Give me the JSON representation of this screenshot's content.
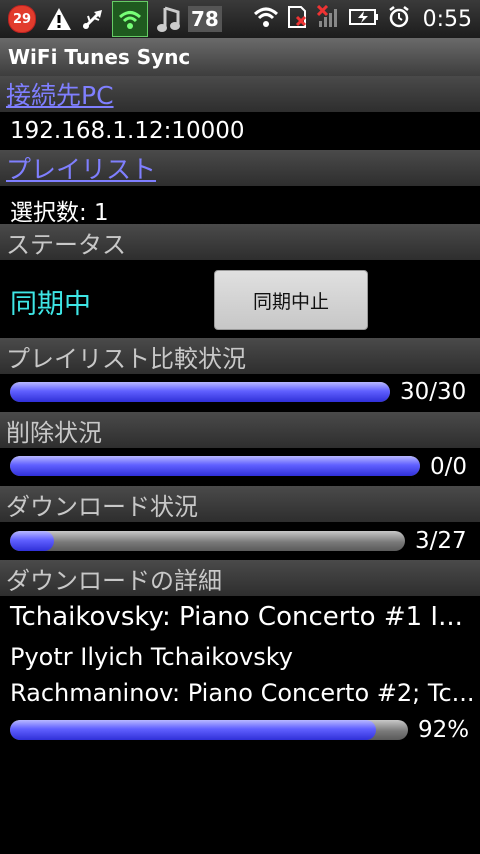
{
  "status_bar": {
    "notification_count": "29",
    "battery_percent": "78",
    "time": "0:55",
    "icons": [
      "warning-icon",
      "usb-icon",
      "shield-icon",
      "music-note-icon",
      "wifi-icon",
      "sim-icon",
      "signal-off-icon",
      "battery-charging-icon",
      "alarm-icon"
    ]
  },
  "app": {
    "title": "WiFi Tunes Sync"
  },
  "connection": {
    "header": "接続先PC",
    "value": "192.168.1.12:10000"
  },
  "playlist": {
    "header": "プレイリスト",
    "value": "選択数: 1"
  },
  "status": {
    "header": "ステータス",
    "state": "同期中",
    "stop_button": "同期中止"
  },
  "playlist_compare": {
    "header": "プレイリスト比較状況",
    "label": "30/30",
    "progress": 1.0
  },
  "delete": {
    "header": "削除状況",
    "label": "0/0",
    "progress": 1.0
  },
  "download": {
    "header": "ダウンロード状況",
    "label": "3/27",
    "progress": 0.111
  },
  "download_detail": {
    "header": "ダウンロードの詳細",
    "title": "Tchaikovsky: Piano Concerto #1 I...",
    "artist": "Pyotr Ilyich Tchaikovsky",
    "album": "Rachmaninov: Piano Concerto #2; Tc...",
    "label": "92%",
    "progress": 0.92
  },
  "colors": {
    "accent_link": "#7f7fff",
    "syncing": "#3ee6e6",
    "bar_fill": "#6060ff"
  }
}
